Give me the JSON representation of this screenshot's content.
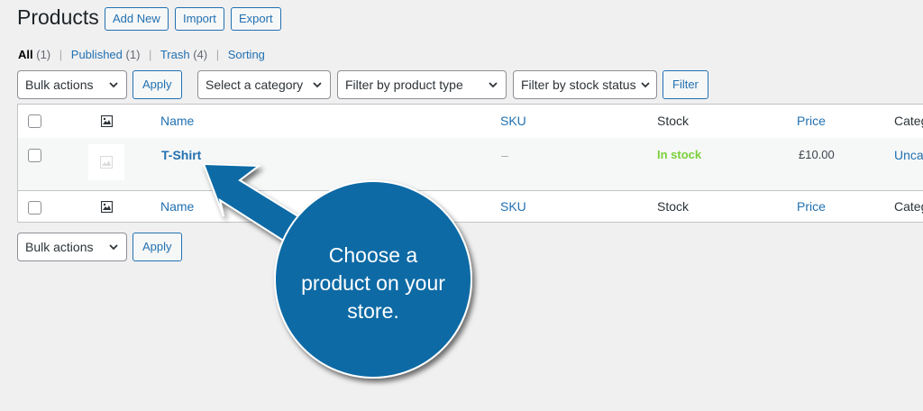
{
  "header": {
    "title": "Products",
    "add_new": "Add New",
    "import": "Import",
    "export": "Export"
  },
  "views": {
    "all": "All",
    "all_count": "(1)",
    "published": "Published",
    "published_count": "(1)",
    "trash": "Trash",
    "trash_count": "(4)",
    "sorting": "Sorting",
    "separator": "|"
  },
  "filters": {
    "bulk_actions": "Bulk actions",
    "apply": "Apply",
    "category": "Select a category",
    "product_type": "Filter by product type",
    "stock_status": "Filter by stock status",
    "filter": "Filter"
  },
  "table": {
    "columns": {
      "name": "Name",
      "sku": "SKU",
      "stock": "Stock",
      "price": "Price",
      "categories": "Categ"
    },
    "rows": [
      {
        "name": "T-Shirt",
        "sku": "–",
        "stock": "In stock",
        "price": "£10.00",
        "category": "Uncat"
      }
    ]
  },
  "callout": {
    "line1": "Choose a",
    "line2": "product on your",
    "line3": "store."
  },
  "colors": {
    "accent": "#2271b1",
    "in_stock": "#7ad03a",
    "callout": "#0a6aa5"
  }
}
